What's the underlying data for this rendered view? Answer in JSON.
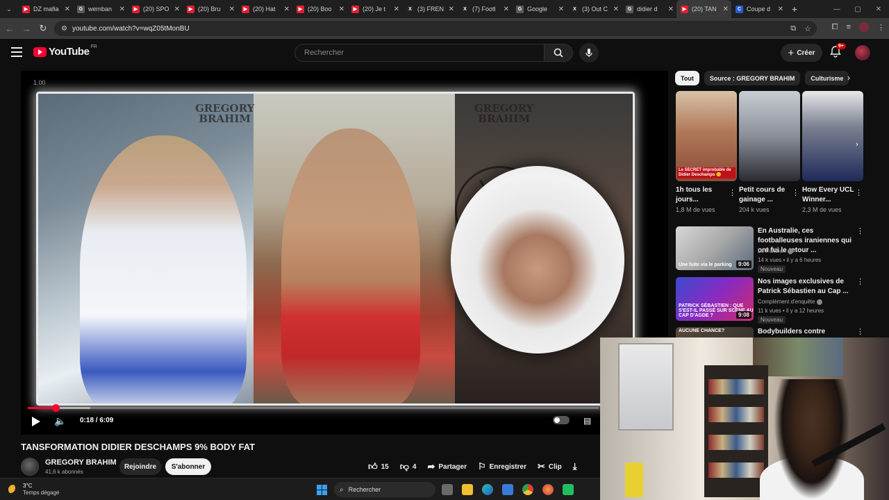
{
  "browser": {
    "tabs": [
      {
        "title": "DZ mafia",
        "color": "#e02030",
        "glyph": "▶"
      },
      {
        "title": "wemban",
        "color": "#5a5a5a",
        "glyph": "G"
      },
      {
        "title": "(20) SPO",
        "color": "#e02030",
        "glyph": "▶"
      },
      {
        "title": "(20) Bru",
        "color": "#e02030",
        "glyph": "▶"
      },
      {
        "title": "(20) Hat",
        "color": "#e02030",
        "glyph": "▶"
      },
      {
        "title": "(20) Boo",
        "color": "#e02030",
        "glyph": "▶"
      },
      {
        "title": "(20) Je t",
        "color": "#e02030",
        "glyph": "▶"
      },
      {
        "title": "(3) FREN",
        "color": "#222222",
        "glyph": "X"
      },
      {
        "title": "(7) Footl",
        "color": "#222222",
        "glyph": "X"
      },
      {
        "title": "Google",
        "color": "#5a5a5a",
        "glyph": "G"
      },
      {
        "title": "(3) Out C",
        "color": "#222222",
        "glyph": "X"
      },
      {
        "title": "didier d",
        "color": "#5a5a5a",
        "glyph": "G"
      },
      {
        "title": "(20) TAN",
        "color": "#e02030",
        "glyph": "▶",
        "active": true
      },
      {
        "title": "Coupe d",
        "color": "#2a5ad0",
        "glyph": "C"
      }
    ],
    "url": "youtube.com/watch?v=wqZ05tMonBU"
  },
  "header": {
    "logo_text": "YouTube",
    "region": "FR",
    "search_placeholder": "Rechercher",
    "create_label": "Créer",
    "notif_count": "9+"
  },
  "player": {
    "speed": "1.00",
    "watermark_line1": "GREGORY",
    "watermark_line2": "BRAHIM",
    "time": "0:18 / 6:09",
    "played_fraction": 0.049,
    "buffered_fraction": 0.11
  },
  "video": {
    "title": "TANSFORMATION DIDIER DESCHAMPS 9% BODY FAT",
    "channel": "GREGORY BRAHIM",
    "subscribers": "41,6 k abonnés",
    "join_label": "Rejoindre",
    "subscribe_label": "S'abonner",
    "likes": "15",
    "dislikes": "4",
    "share_label": "Partager",
    "save_label": "Enregistrer",
    "clip_label": "Clip"
  },
  "sidebar": {
    "chips": [
      "Tout",
      "Source : GREGORY BRAHIM",
      "Culturisme"
    ],
    "shorts": [
      {
        "title": "1h tous les jours... ",
        "views": "1,8 M de vues",
        "overlay": "Le SECRET improbable de Didier Deschamps 🤫",
        "bg": "linear-gradient(180deg,#d8c2a8,#b07858 45%,#8a4a38)"
      },
      {
        "title": "Petit cours de gainage ...",
        "views": "204 k vues",
        "overlay": "",
        "bg": "linear-gradient(180deg,#c8cdd4,#8a8f98 50%,#2a2c32)"
      },
      {
        "title": "How Every UCL Winner...",
        "views": "2,3 M de vues",
        "overlay": "",
        "bg": "linear-gradient(180deg,#e8e8ea,#7a8090 40%,#1e2a5a)"
      }
    ],
    "recommendations": [
      {
        "title": "En Australie, ces footballeuses iraniennes qui ont fui le retour ...",
        "channel": "Le Parisien",
        "meta": "14 k vues • il y a 6 heures",
        "badge": "Nouveau",
        "duration": "9:06",
        "caption": "Une fuite via le parking",
        "bg": "linear-gradient(135deg,#d8d8d8,#a8a8a8 50%,#5a6a7a)"
      },
      {
        "title": "Nos images exclusives de Patrick Sébastien au Cap ...",
        "channel": "Complément d'enquête",
        "meta": "11 k vues • il y a 12 heures",
        "badge": "Nouveau",
        "duration": "9:08",
        "caption": "PATRICK SÉBASTIEN : QUE S'EST-IL PASSÉ SUR SCÈNE AU CAP D'AGDE ?",
        "bg": "linear-gradient(135deg,#3a4ad0,#8a2ac0 50%,#d02a6a)"
      },
      {
        "title": "Bodybuilders contre militaires:",
        "channel": "",
        "meta": "",
        "badge": "",
        "duration": "",
        "caption": "AUCUNE CHANCE?",
        "bg": "linear-gradient(135deg,#5a4a3a,#2a2a2a)"
      }
    ]
  },
  "taskbar": {
    "temperature": "3°C",
    "weather": "Temps dégagé",
    "search_placeholder": "Rechercher"
  }
}
